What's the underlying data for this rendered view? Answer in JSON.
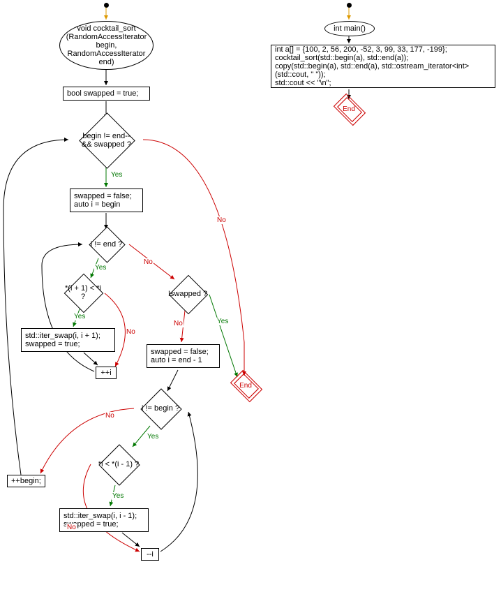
{
  "left": {
    "start_node": "void cocktail_sort (RandomAccessIterator begin, RandomAccessIterator end)",
    "n1": "bool swapped = true;",
    "d1": "begin != end-- && swapped ?",
    "n2": "swapped = false; auto i = begin",
    "d2": "i != end ?",
    "d3": "*(i + 1) < *i ?",
    "d4": "!swapped ?",
    "n3": "std::iter_swap(i, i + 1); swapped = true;",
    "n4": "++i",
    "n5": "swapped = false; auto i = end - 1",
    "d5": "i != begin ?",
    "d6": "*i < *(i - 1) ?",
    "n6": "std::iter_swap(i, i - 1); swapped = true;",
    "n7": "--i",
    "n8": "++begin;",
    "end": "End"
  },
  "right": {
    "start_node": "int main()",
    "body": "int a[] = {100, 2, 56, 200, -52, 3, 99, 33, 177, -199};\ncocktail_sort(std::begin(a), std::end(a));\ncopy(std::begin(a), std::end(a), std::ostream_iterator<int>(std::cout, \" \"));\nstd::cout << \"\\n\";",
    "end": "End"
  },
  "labels": {
    "yes": "Yes",
    "no": "No"
  }
}
